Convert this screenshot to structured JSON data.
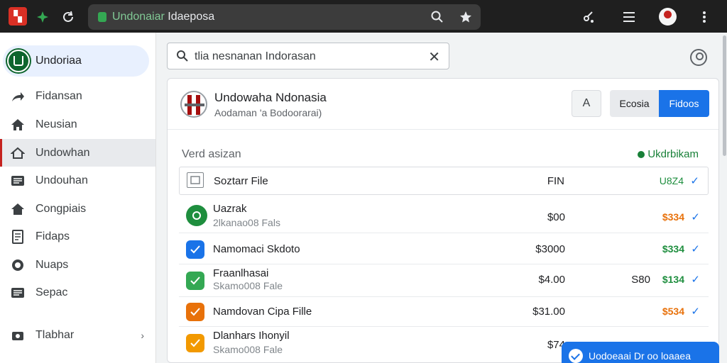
{
  "browser": {
    "url_prefix": "Undonaiar",
    "url_rest": " Idaeposa"
  },
  "sidebar": {
    "header_label": "Undoriaa",
    "items": [
      {
        "label": "Fidansan",
        "icon": "arrow-icon"
      },
      {
        "label": "Neusian",
        "icon": "home-icon"
      },
      {
        "label": "Undowhan",
        "icon": "home-outline-icon",
        "active": true
      },
      {
        "label": "Undouhan",
        "icon": "list-icon"
      },
      {
        "label": "Congpiais",
        "icon": "home-icon"
      },
      {
        "label": "Fidaps",
        "icon": "doc-icon"
      },
      {
        "label": "Nuaps",
        "icon": "circle-icon"
      },
      {
        "label": "Sepac",
        "icon": "list-icon"
      },
      {
        "label": "Tlabhar",
        "icon": "camera-icon",
        "chevron": "›"
      }
    ]
  },
  "search": {
    "value": "tlia nesnanan Indorasan"
  },
  "card": {
    "title": "Undowaha Ndonasia",
    "subtitle": "Aodaman 'a Bodoorarai)",
    "btn_a": "A",
    "btn_b": "Ecosia",
    "btn_c": "Fidoos",
    "section_label": "Verd asizan",
    "section_status": "Ukdrbikam",
    "header_row": {
      "name": "Soztarr File",
      "amount": "FIN",
      "value": "U8Z4"
    },
    "rows": [
      {
        "name": "Uazrak",
        "sub": "2lkanao08 Fals",
        "amount": "$00",
        "amount2": "",
        "value": "$334",
        "value_color": "orange",
        "icon_color": "#1e8e3e",
        "icon": "circle-icon"
      },
      {
        "name": "Namomaci Skdoto",
        "sub": "",
        "amount": "$3000",
        "amount2": "",
        "value": "$334",
        "value_color": "green",
        "icon_color": "#1a73e8",
        "icon": "check-icon"
      },
      {
        "name": "Fraanlhasai",
        "sub": "Skamo008 Fale",
        "amount": "$4.00",
        "amount2": "S80",
        "value": "$134",
        "value_color": "green",
        "icon_color": "#34a853",
        "icon": "check-icon"
      },
      {
        "name": "Namdovan Cipa Fille",
        "sub": "",
        "amount": "$31.00",
        "amount2": "",
        "value": "$534",
        "value_color": "orange",
        "icon_color": "#e8710a",
        "icon": "check-icon"
      },
      {
        "name": "Dlanhars Ihonyil",
        "sub": "Skamo008 Fale",
        "amount": "$74",
        "amount2": "",
        "value": "",
        "value_color": "",
        "icon_color": "#f29900",
        "icon": "check-icon"
      }
    ]
  },
  "toast": {
    "text": "Uodoeaai Dr oo loaaea"
  },
  "colors": {
    "accent": "#1a73e8",
    "brand_red": "#d93025",
    "success": "#1e8e3e"
  }
}
